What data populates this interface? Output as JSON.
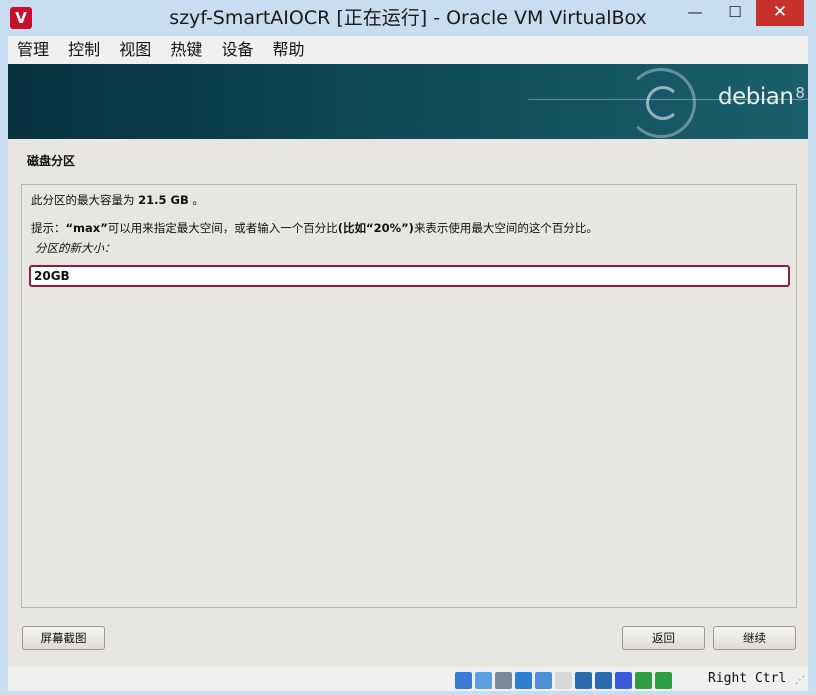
{
  "window": {
    "title": "szyf-SmartAIOCR [正在运行] - Oracle VM VirtualBox",
    "app_icon": "virtualbox-icon",
    "minimize_glyph": "—",
    "maximize_glyph": "☐",
    "close_glyph": "✕"
  },
  "menu": {
    "items": [
      "管理",
      "控制",
      "视图",
      "热键",
      "设备",
      "帮助"
    ]
  },
  "banner": {
    "brand": "debian",
    "version": "8"
  },
  "installer": {
    "section_title": "磁盘分区",
    "max_capacity_prefix": "此分区的最大容量为 ",
    "max_capacity_value": "21.5 GB",
    "max_capacity_suffix": " 。",
    "hint_prefix": "提示：",
    "hint_max": "“max”",
    "hint_middle": "可以用来指定最大空间，或者输入一个百分比",
    "hint_example": "(比如“20%”)",
    "hint_suffix": "来表示使用最大空间的这个百分比。",
    "field_label": "分区的新大小：",
    "size_value": "20GB"
  },
  "buttons": {
    "screenshot": "屏幕截图",
    "back": "返回",
    "continue": "继续"
  },
  "statusbar": {
    "icons": [
      "hard-disk-icon",
      "optical-drive-icon",
      "audio-icon",
      "network-icon",
      "usb-icon",
      "shared-folder-icon",
      "display-icon",
      "recording-icon",
      "cpu-virtualization-icon",
      "mouse-integration-icon",
      "keyboard-capture-icon"
    ],
    "icon_colors": [
      "#3a7bd5",
      "#5aa0e0",
      "#7a8a99",
      "#2f7fd1",
      "#4a90d9",
      "#d8d8d8",
      "#2b6cb0",
      "#2b6cb0",
      "#3b5bdb",
      "#2f9e44",
      "#2f9e44"
    ],
    "host_key": "Right Ctrl"
  }
}
